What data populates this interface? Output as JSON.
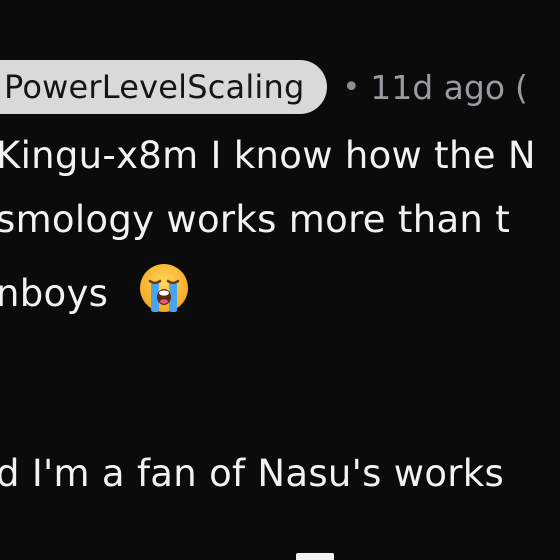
{
  "comment": {
    "author": "PowerLevelScaling",
    "separator": "•",
    "time": "11d ago",
    "trailing": "(",
    "lines": [
      "Kingu-x8m I know how the N",
      "smology works more than t",
      "nboys",
      "d I'm a fan of Nasu's works"
    ],
    "emoji": "loudly-crying-face"
  },
  "colors": {
    "background": "#0b0b0c",
    "chip": "#d9d9da",
    "text": "#f2f2f2",
    "muted": "#9a9aa0"
  }
}
